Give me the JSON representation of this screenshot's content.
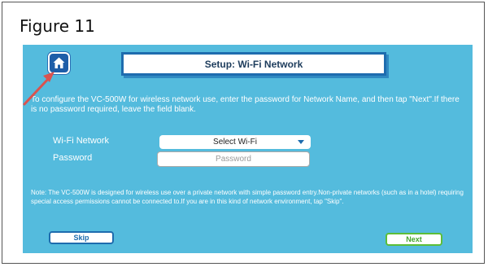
{
  "figure": {
    "title": "Figure 11"
  },
  "header": {
    "title": "Setup: Wi-Fi Network",
    "home_icon": "home-icon"
  },
  "instructions": "To configure the VC-500W for wireless network use, enter the password for Network Name, and then tap \"Next\".If there is no password required, leave the field blank.",
  "form": {
    "wifi_label": "Wi-Fi Network",
    "wifi_value": "Select Wi-Fi",
    "password_label": "Password",
    "password_placeholder": "Password"
  },
  "note": "Note: The VC-500W is designed for wireless use over a private network with simple password entry.Non-private networks (such as in a hotel) requiring special access permissions cannot be connected to.If you are in this kind of network environment, tap \"Skip\".",
  "buttons": {
    "skip": "Skip",
    "next": "Next"
  },
  "colors": {
    "screen_bg": "#54bbdd",
    "accent": "#1e6cae",
    "next_green": "#5cbe38",
    "arrow_red": "#d9534f"
  }
}
